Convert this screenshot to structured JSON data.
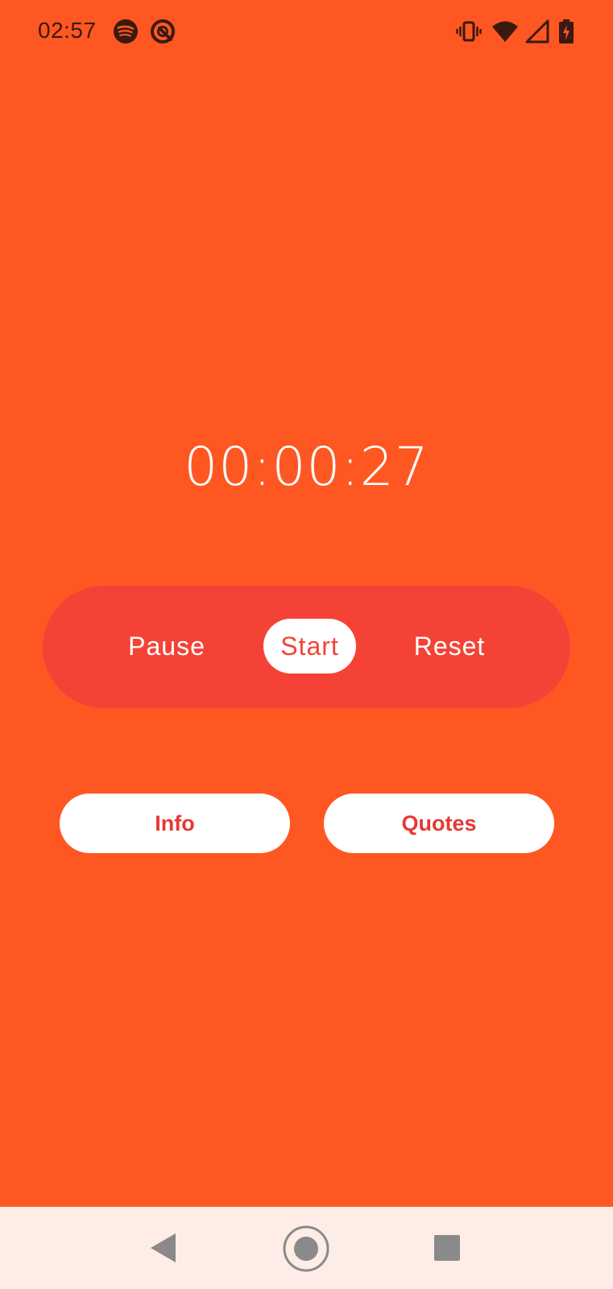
{
  "status_bar": {
    "time": "02:57",
    "left_icons": [
      "spotify-icon",
      "notification-app-icon"
    ],
    "right_icons": [
      "vibrate-icon",
      "wifi-icon",
      "cellular-signal-icon",
      "battery-charging-icon"
    ]
  },
  "stopwatch": {
    "time_display": "00:00:27"
  },
  "controls": {
    "pause_label": "Pause",
    "start_label": "Start",
    "reset_label": "Reset",
    "selected": "Start"
  },
  "actions": {
    "info_label": "Info",
    "quotes_label": "Quotes"
  },
  "nav_bar": {
    "buttons": [
      "back-icon",
      "home-icon",
      "recents-icon"
    ]
  },
  "colors": {
    "background": "#FF5722",
    "control_pill": "#F44336",
    "accent_text": "#E53935",
    "nav_bar": "#FEEDE6"
  }
}
